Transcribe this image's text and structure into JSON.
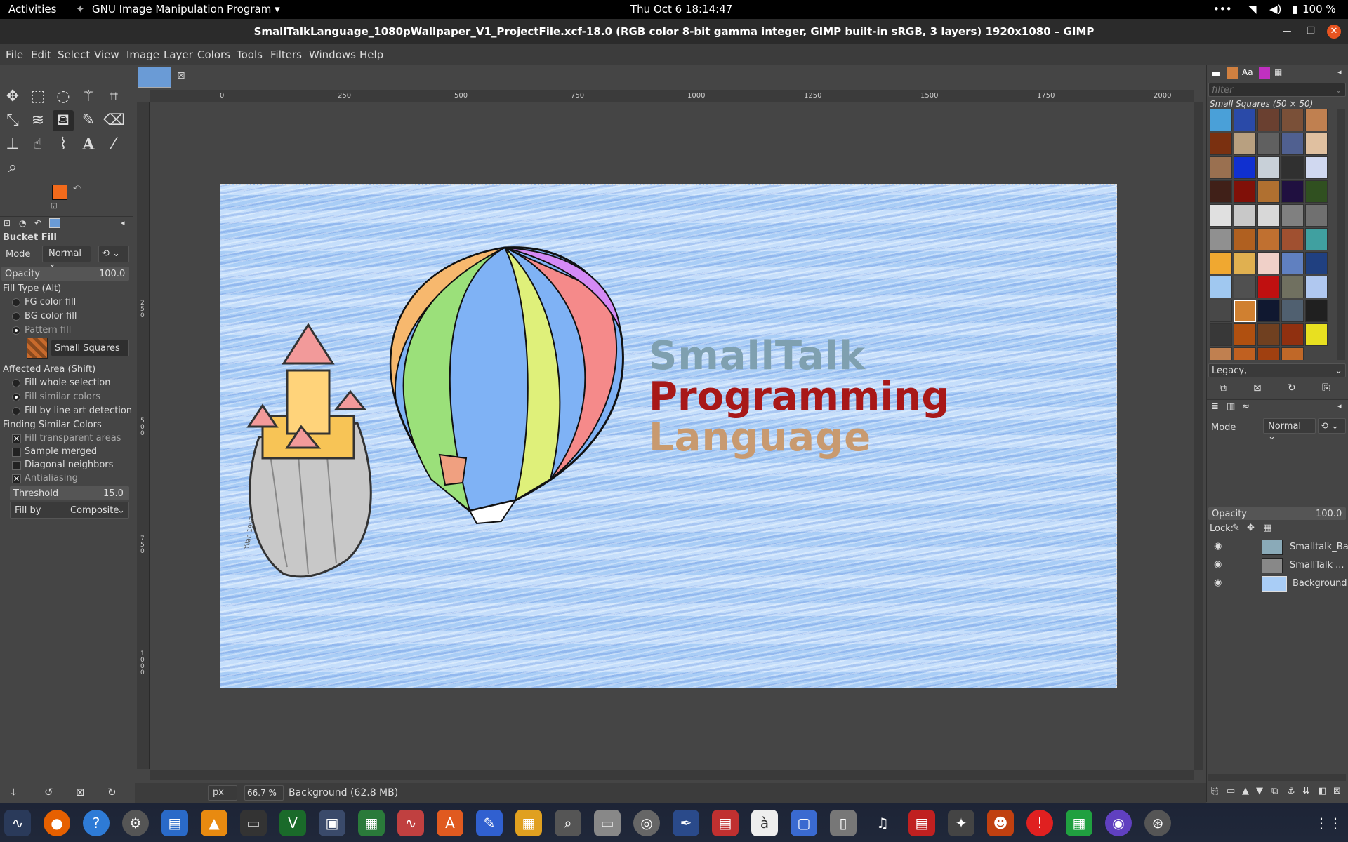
{
  "topbar": {
    "activities": "Activities",
    "app_menu": "GNU Image Manipulation Program ▾",
    "clock": "Thu Oct 6  18:14:47",
    "battery": "100 %"
  },
  "window": {
    "title": "SmallTalkLanguage_1080pWallpaper_V1_ProjectFile.xcf-18.0 (RGB color 8-bit gamma integer, GIMP built-in sRGB, 3 layers) 1920x1080 – GIMP"
  },
  "menu": [
    "File",
    "Edit",
    "Select",
    "View",
    "Image",
    "Layer",
    "Colors",
    "Tools",
    "Filters",
    "Windows",
    "Help"
  ],
  "colors": {
    "fg": "#f26a1b",
    "bg": "#a0a0a0",
    "accent": "#6a9bd6"
  },
  "tool_options": {
    "title": "Bucket Fill",
    "mode_label": "Mode",
    "mode_value": "Normal",
    "opacity_label": "Opacity",
    "opacity_value": "100.0",
    "fill_type_label": "Fill Type  (Alt)",
    "fill_types": [
      "FG color fill",
      "BG color fill",
      "Pattern fill"
    ],
    "pattern_name": "Small Squares",
    "affected_label": "Affected Area  (Shift)",
    "affected": [
      "Fill whole selection",
      "Fill similar colors",
      "Fill by line art detection"
    ],
    "similar_label": "Finding Similar Colors",
    "similar_opts": [
      "Fill transparent areas",
      "Sample merged",
      "Diagonal neighbors",
      "Antialiasing"
    ],
    "threshold_label": "Threshold",
    "threshold_value": "15.0",
    "fillby_label": "Fill by",
    "fillby_value": "Composite"
  },
  "ruler": {
    "h": [
      "0",
      "250",
      "500",
      "750",
      "1000",
      "1250",
      "1500",
      "1750",
      "2000"
    ],
    "v": [
      "2\n5\n0",
      "5\n0\n0",
      "7\n5\n0",
      "1\n0\n0\n0"
    ]
  },
  "artwork": {
    "line1": "SmallTalk",
    "line2": "Programming",
    "line3": "Language",
    "castle_sig": "Yilan 1997"
  },
  "status": {
    "unit": "px",
    "zoom": "66.7 %",
    "layer_info": "Background (62.8 MB)"
  },
  "patterns": {
    "filter_placeholder": "filter",
    "name": "Small Squares (50 × 50)",
    "tag": "Legacy,"
  },
  "layers": {
    "mode_label": "Mode",
    "mode_value": "Normal",
    "opacity_label": "Opacity",
    "opacity_value": "100.0",
    "lock_label": "Lock:",
    "items": [
      {
        "name": "Smalltalk_Ballo"
      },
      {
        "name": "SmallTalk ..."
      },
      {
        "name": "Background"
      }
    ]
  }
}
